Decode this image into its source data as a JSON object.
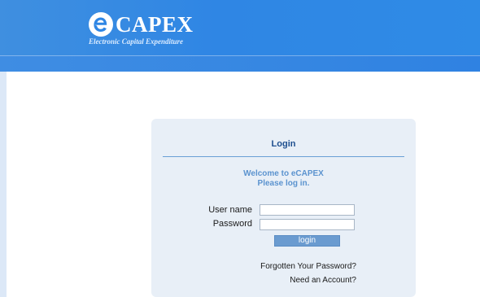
{
  "header": {
    "logo_text": "CAPEX",
    "tagline": "Electronic Capital Expenditure",
    "logo_icon": "e-logo-icon",
    "colors": {
      "header_blue": "#2f86e4",
      "band_blue": "#3f8de3",
      "panel_bg": "#e8eff7",
      "title_blue": "#1e4f8f",
      "welcome_blue": "#5b93cf",
      "button_blue": "#6a9bd0"
    }
  },
  "login": {
    "title": "Login",
    "welcome_line1": "Welcome to eCAPEX",
    "welcome_line2": "Please log in.",
    "username_label": "User name",
    "password_label": "Password",
    "username_value": "",
    "password_value": "",
    "button_label": "login",
    "forgot_password": "Forgotten Your Password?",
    "need_account": "Need an Account?"
  }
}
